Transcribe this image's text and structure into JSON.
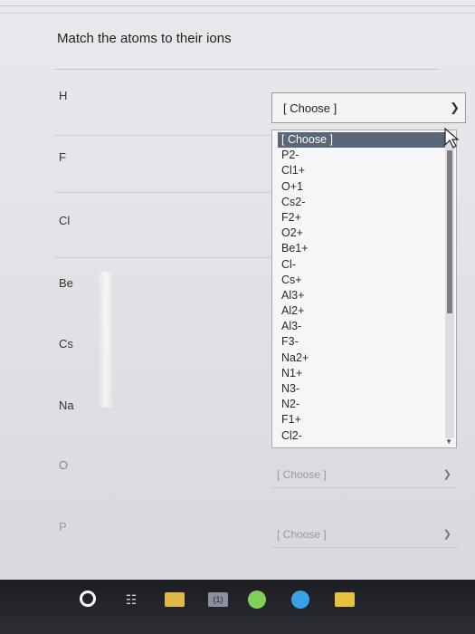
{
  "question": {
    "title": "Match the atoms to their ions"
  },
  "rows": [
    {
      "label": "H"
    },
    {
      "label": "F"
    },
    {
      "label": "Cl"
    },
    {
      "label": "Be"
    },
    {
      "label": "Cs"
    },
    {
      "label": "Na"
    },
    {
      "label": "O"
    },
    {
      "label": "P"
    }
  ],
  "select_h": {
    "value": "[ Choose ]"
  },
  "dropdown": {
    "options": [
      "[ Choose ]",
      "P2-",
      "Cl1+",
      "O+1",
      "Cs2-",
      "F2+",
      "O2+",
      "Be1+",
      "Cl-",
      "Cs+",
      "Al3+",
      "Al2+",
      "Al3-",
      "F3-",
      "Na2+",
      "N1+",
      "N3-",
      "N2-",
      "F1+",
      "Cl2-"
    ],
    "selected_index": 0
  },
  "select_o": {
    "value": "[ Choose ]"
  },
  "select_p": {
    "value": "[ Choose ]"
  },
  "taskbar": {
    "mail_badge": "(1)"
  }
}
